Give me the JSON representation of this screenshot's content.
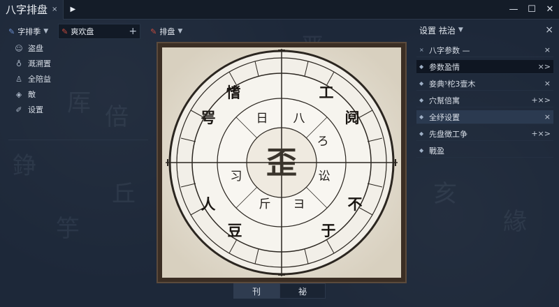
{
  "window": {
    "tab_title": "八字排盘",
    "tab_close": "×",
    "tab_play": "▶",
    "controls": [
      "—",
      "☐",
      "✕"
    ]
  },
  "toolbar": {
    "item1": "字排季",
    "item2": "爽欢盘",
    "item2_plus": "+",
    "item3": "排盘"
  },
  "left_menu": [
    {
      "label": "盗盘",
      "icon": "person-icon"
    },
    {
      "label": "溉溯置",
      "icon": "bulb-icon"
    },
    {
      "label": "全陪益",
      "icon": "user-icon"
    },
    {
      "label": "敵",
      "icon": "cube-icon"
    },
    {
      "label": "设置",
      "icon": "wrench-icon"
    }
  ],
  "board": {
    "center": "歪",
    "inner_ring": [
      "八",
      "ろ",
      "讼",
      "ヨ",
      "斤",
      "习",
      "日"
    ],
    "outer_ring": [
      "工",
      "阋",
      "不",
      "于",
      "豆",
      "人",
      "咢",
      "愭"
    ]
  },
  "bottom_tabs": [
    "刊",
    "祕"
  ],
  "right_panel": {
    "header": "设置 祛治",
    "header_close": "×",
    "rows": [
      {
        "label": "八字参数 —",
        "prefix": "×",
        "actions": "×",
        "style": "plain"
      },
      {
        "label": "参数盈情",
        "prefix": "◆",
        "actions": "×>",
        "style": "sel"
      },
      {
        "label": "妾典⁵柁3壹木",
        "prefix": "◆",
        "actions": "×",
        "style": "plain"
      },
      {
        "label": "穴幫倍寓",
        "prefix": "◆",
        "actions": "+×>",
        "style": "plain"
      },
      {
        "label": "全纾设置",
        "prefix": "◆",
        "actions": "×",
        "style": "hl"
      },
      {
        "label": "先盘徴工争",
        "prefix": "◆",
        "actions": "+×>",
        "style": "plain"
      },
      {
        "label": "戰盈",
        "prefix": "◆",
        "actions": "",
        "style": "plain"
      }
    ]
  }
}
